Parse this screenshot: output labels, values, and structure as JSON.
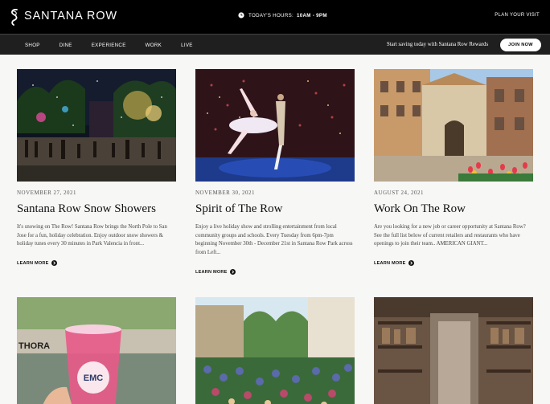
{
  "header": {
    "logo_text": "SANTANA ROW",
    "hours_label": "TODAY'S HOURS:",
    "hours_value": "10AM - 9PM",
    "plan_visit": "PLAN YOUR VISIT"
  },
  "nav": {
    "items": [
      "SHOP",
      "DINE",
      "EXPERIENCE",
      "WORK",
      "LIVE"
    ],
    "rewards_text": "Start saving today with Santana Row Rewards",
    "join_label": "JOIN NOW"
  },
  "cards": [
    {
      "date": "NOVEMBER 27, 2021",
      "title": "Santana Row Snow Showers",
      "excerpt": "It's snowing on The Row! Santana Row brings the North Pole to San Jose for a fun, holiday celebration. Enjoy outdoor snow showers & holiday tunes every 30 minutes in Park Valencia in front...",
      "link": "LEARN MORE"
    },
    {
      "date": "NOVEMBER 30, 2021",
      "title": "Spirit of The Row",
      "excerpt": "Enjoy a live holiday show and strolling entertainment from local community groups and schools. Every Tuesday from 6pm-7pm beginning November 30th - December 21st in Santana Row Park across from Left...",
      "link": "LEARN MORE"
    },
    {
      "date": "AUGUST 24, 2021",
      "title": "Work On The Row",
      "excerpt": "Are you looking for a new job or career opportunity at Santana Row? See the full list below of current retailers and restaurants who have openings to join their team.. AMERICAN GIANT...",
      "link": "LEARN MORE"
    }
  ],
  "second_row": {
    "cup_brand": "EMC",
    "sign_text": "THORA"
  },
  "colors": {
    "header_bg": "#000000",
    "nav_bg": "#1f1f1f",
    "page_bg": "#f7f7f6",
    "join_button_bg": "#ffffff"
  }
}
